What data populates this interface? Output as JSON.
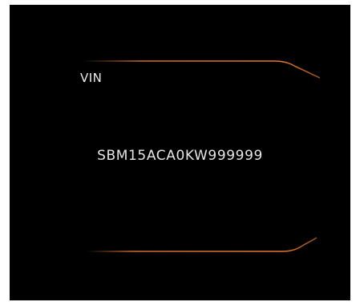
{
  "screen": {
    "label": "VIN",
    "value": "SBM15ACA0KW999999",
    "accent_color": "#e07a2e",
    "background_color": "#000000"
  }
}
